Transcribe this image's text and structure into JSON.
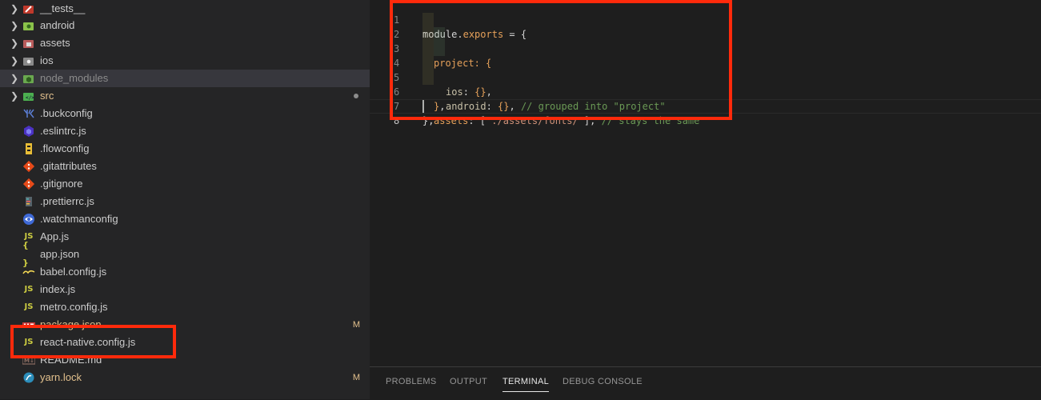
{
  "explorer": {
    "items": [
      {
        "label": "__tests__",
        "type": "folder",
        "icon": "tests-folder-icon"
      },
      {
        "label": "android",
        "type": "folder",
        "icon": "android-folder-icon"
      },
      {
        "label": "assets",
        "type": "folder",
        "icon": "assets-folder-icon"
      },
      {
        "label": "ios",
        "type": "folder",
        "icon": "ios-folder-icon"
      },
      {
        "label": "node_modules",
        "type": "folder",
        "icon": "node-modules-folder-icon"
      },
      {
        "label": "src",
        "type": "folder",
        "icon": "src-folder-icon"
      },
      {
        "label": ".buckconfig",
        "type": "file",
        "icon": "buck-icon"
      },
      {
        "label": ".eslintrc.js",
        "type": "file",
        "icon": "eslint-icon"
      },
      {
        "label": ".flowconfig",
        "type": "file",
        "icon": "flow-icon"
      },
      {
        "label": ".gitattributes",
        "type": "file",
        "icon": "git-icon"
      },
      {
        "label": ".gitignore",
        "type": "file",
        "icon": "git-icon"
      },
      {
        "label": ".prettierrc.js",
        "type": "file",
        "icon": "prettier-icon"
      },
      {
        "label": ".watchmanconfig",
        "type": "file",
        "icon": "watchman-icon"
      },
      {
        "label": "App.js",
        "type": "file",
        "icon": "js-icon",
        "glyph": "JS"
      },
      {
        "label": "app.json",
        "type": "file",
        "icon": "json-icon",
        "glyph": "{ }"
      },
      {
        "label": "babel.config.js",
        "type": "file",
        "icon": "babel-icon"
      },
      {
        "label": "index.js",
        "type": "file",
        "icon": "js-icon",
        "glyph": "JS"
      },
      {
        "label": "metro.config.js",
        "type": "file",
        "icon": "js-icon",
        "glyph": "JS"
      },
      {
        "label": "package.json",
        "type": "file",
        "icon": "npm-icon",
        "badge": "M"
      },
      {
        "label": "react-native.config.js",
        "type": "file",
        "icon": "js-icon",
        "glyph": "JS"
      },
      {
        "label": "README.md",
        "type": "file",
        "icon": "markdown-icon"
      },
      {
        "label": "yarn.lock",
        "type": "file",
        "icon": "yarn-icon",
        "badge": "M"
      }
    ]
  },
  "editor": {
    "lines": [
      {
        "n": "1"
      },
      {
        "n": "2"
      },
      {
        "n": "3"
      },
      {
        "n": "4"
      },
      {
        "n": "5"
      },
      {
        "n": "6"
      },
      {
        "n": "7"
      },
      {
        "n": "8"
      }
    ],
    "code": {
      "l1_module": "module",
      "l1_dot": ".",
      "l1_exports": "exports",
      "l1_rest": " = {",
      "l2_key": "project",
      "l2_rest": ": {",
      "l3_key": "ios",
      "l3_colon": ": ",
      "l3_braces": "{}",
      "l3_comma": ",",
      "l4_key": "android",
      "l4_colon": ": ",
      "l4_braces": "{}",
      "l4_comma": ", ",
      "l4_comment": "// grouped into \"project\"",
      "l5_close": "}",
      "l5_comma": ",",
      "l6_key": "assets",
      "l6_colon": ": [",
      "l6_str": "\"./assets/fonts/\"",
      "l6_rest": "], ",
      "l6_comment": "// stays the same",
      "l7": "};"
    }
  },
  "panel": {
    "tabs": [
      "PROBLEMS",
      "OUTPUT",
      "TERMINAL",
      "DEBUG CONSOLE"
    ],
    "active": "TERMINAL"
  },
  "colors": {
    "highlight_box": "#ff2a0b",
    "modified": "#e2c08d"
  }
}
